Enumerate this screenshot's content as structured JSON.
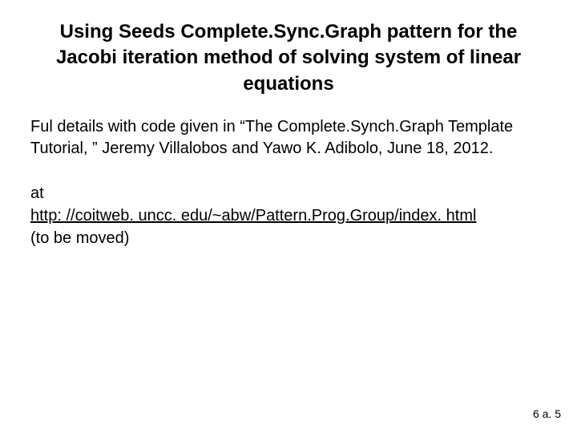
{
  "title": "Using Seeds Complete.Sync.Graph pattern for the Jacobi iteration method of solving system of linear equations",
  "body": {
    "p1": "Ful details with code given in “The Complete.Synch.Graph Template Tutorial, ” Jeremy Villalobos and Yawo K. Adibolo, June 18, 2012.",
    "p2_prefix": "at",
    "p2_url": "http: //coitweb. uncc. edu/~abw/Pattern.Prog.Group/index. html",
    "p2_suffix": "(to be moved)"
  },
  "page_number": "6 a. 5"
}
